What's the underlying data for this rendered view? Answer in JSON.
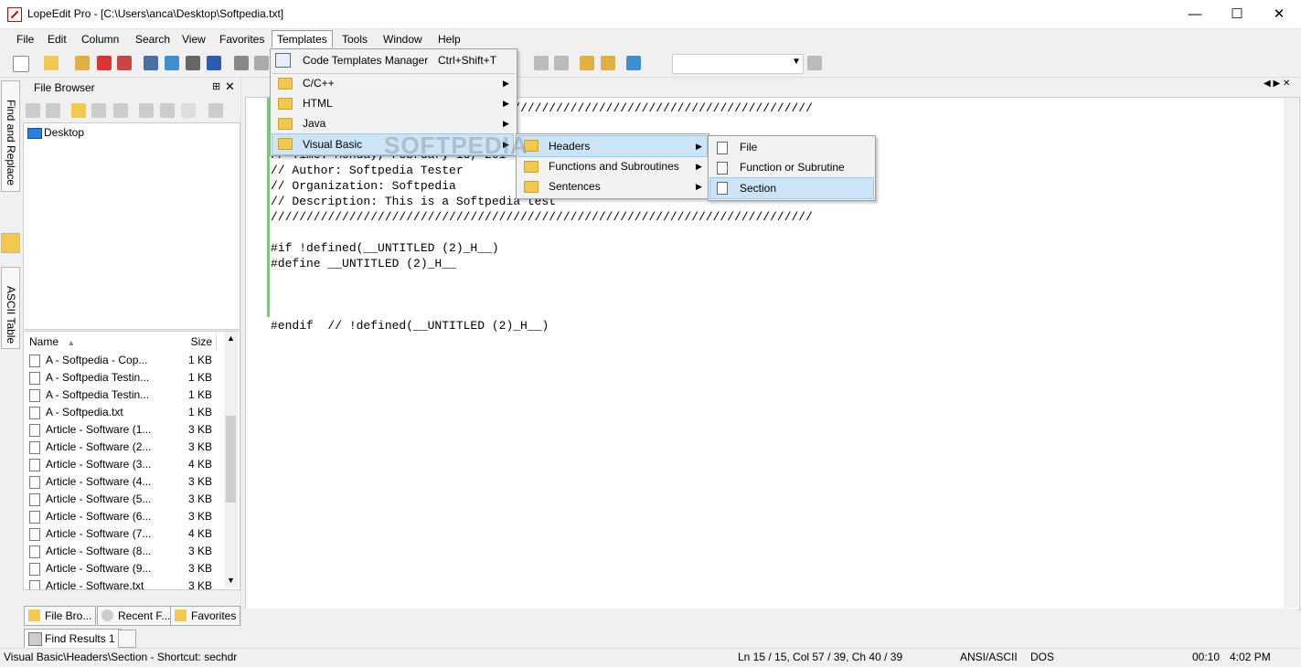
{
  "window": {
    "title": "LopeEdit Pro - [C:\\Users\\anca\\Desktop\\Softpedia.txt]",
    "minimize": "—",
    "maximize": "☐",
    "close": "✕"
  },
  "menu": [
    "File",
    "Edit",
    "Column",
    "Search",
    "View",
    "Favorites",
    "Templates",
    "Tools",
    "Window",
    "Help"
  ],
  "side_tabs": {
    "find_replace": "Find and Replace",
    "ascii_table": "ASCII Table"
  },
  "file_browser": {
    "title": "File Browser",
    "tree_root": "Desktop",
    "columns": {
      "name": "Name",
      "size": "Size"
    },
    "files": [
      {
        "name": "A - Softpedia - Cop...",
        "size": "1 KB"
      },
      {
        "name": "A - Softpedia Testin...",
        "size": "1 KB"
      },
      {
        "name": "A - Softpedia Testin...",
        "size": "1 KB"
      },
      {
        "name": "A - Softpedia.txt",
        "size": "1 KB"
      },
      {
        "name": "Article - Software (1...",
        "size": "3 KB"
      },
      {
        "name": "Article - Software (2...",
        "size": "3 KB"
      },
      {
        "name": "Article - Software (3...",
        "size": "4 KB"
      },
      {
        "name": "Article - Software (4...",
        "size": "3 KB"
      },
      {
        "name": "Article - Software (5...",
        "size": "3 KB"
      },
      {
        "name": "Article - Software (6...",
        "size": "3 KB"
      },
      {
        "name": "Article - Software (7...",
        "size": "4 KB"
      },
      {
        "name": "Article - Software (8...",
        "size": "3 KB"
      },
      {
        "name": "Article - Software (9...",
        "size": "3 KB"
      },
      {
        "name": "Article - Software.txt",
        "size": "3 KB"
      }
    ],
    "bottom_tabs": [
      "File Bro...",
      "Recent F...",
      "Favorites"
    ]
  },
  "editor": {
    "lines": [
      "////////////////////////////////////////////////////////////////////////////",
      "// Time: Monday, February 13, 201",
      "// Author: Softpedia Tester",
      "// Organization: Softpedia",
      "// Description: This is a Softpedia test",
      "////////////////////////////////////////////////////////////////////////////",
      "#if !defined(__UNTITLED (2)_H__)",
      "#define __UNTITLED (2)_H__",
      "#endif  // !defined(__UNTITLED (2)_H__)"
    ]
  },
  "templates_menu": {
    "items": [
      {
        "label": "Code Templates Manager",
        "shortcut": "Ctrl+Shift+T"
      },
      {
        "label": "C/C++"
      },
      {
        "label": "HTML"
      },
      {
        "label": "Java"
      },
      {
        "label": "Visual Basic"
      }
    ],
    "vb_submenu": [
      "Headers",
      "Functions and Subroutines",
      "Sentences"
    ],
    "headers_submenu": [
      "File",
      "Function or Subrutine",
      "Section"
    ]
  },
  "watermark": "SOFTPEDIA",
  "find_results": "Find Results 1",
  "status": {
    "message": "Visual Basic\\Headers\\Section - Shortcut: sechdr",
    "position": "Ln 15 / 15, Col 57 / 39, Ch 40 / 39",
    "encoding": "ANSI/ASCII",
    "line_ending": "DOS",
    "elapsed": "00:10",
    "clock": "4:02 PM"
  },
  "colors": {
    "menu_highlight": "#cce4f7",
    "change_bar": "#7ec87e",
    "folder": "#f2c94c"
  }
}
